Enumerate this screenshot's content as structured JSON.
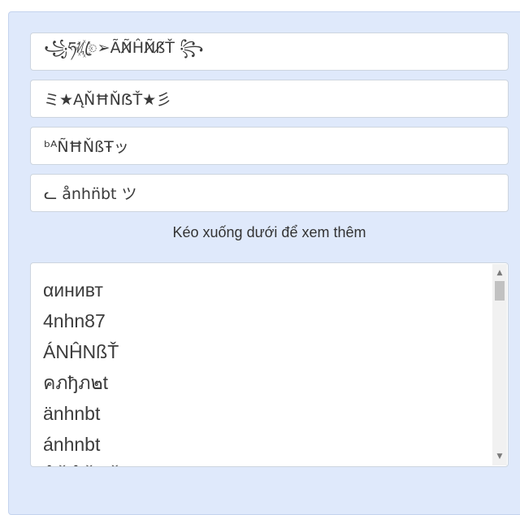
{
  "styled_names": [
    "꧁ཧᜰ꙰ꦿ➢ÃÑ̸ĤÑ̸ß̸Ť ꧂",
    "ミ★ĄŇĦŇẞŤ★彡",
    "ᵇᴬÑĦŇßŦッ",
    "ᓚ ånhn̈bt ツ"
  ],
  "hint_text": "Kéo xuống dưới để xem thêm",
  "list_items": [
    "αинивт",
    "4nhn87",
    "ÁNĤNßŤ",
    "คภђภ๒t",
    "änhnbt",
    "ánhnbt",
    "ÂŇĤŇẞŤ"
  ],
  "scrollbar": {
    "up_icon": "▲",
    "down_icon": "▼"
  }
}
